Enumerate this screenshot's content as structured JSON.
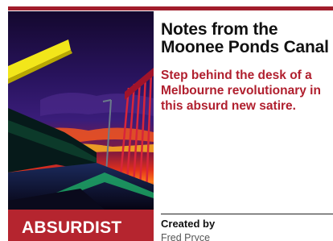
{
  "theme": {
    "accent_color": "#a11d2b",
    "band_color": "#b5252f"
  },
  "card": {
    "category": "ABSURDIST",
    "title": "Notes from the Moonee Ponds Canal",
    "blurb": "Step behind the desk of a Melbourne revolutionary in this absurd new satire.",
    "credit_label": "Created by",
    "credit_name": "Fred Pryce",
    "cover_image": "stylized-canal-bridge-sunset-artwork"
  }
}
